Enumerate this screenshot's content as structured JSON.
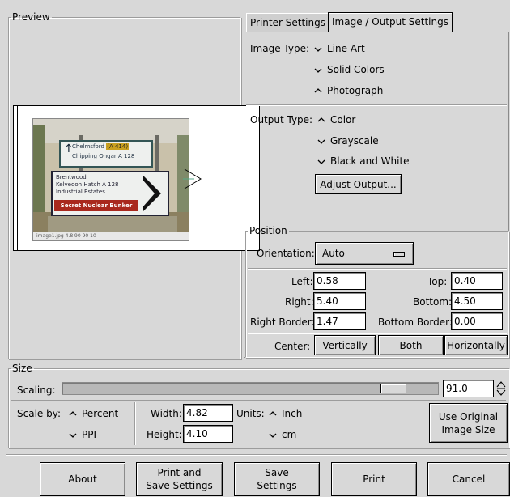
{
  "preview": {
    "frame_label": "Preview",
    "sign": {
      "line1": "Chelmsford",
      "line1_badge": "(A 414)",
      "line2": "Chipping Ongar  A 128",
      "line3": "Brentwood",
      "line4": "Kelvedon Hatch  A 128",
      "line5": "Industrial Estates",
      "banner": "Secret Nuclear Bunker"
    },
    "status_text": "image1.jpg 4.8 90 90 10"
  },
  "tabs": [
    {
      "label": "Printer Settings",
      "selected": false
    },
    {
      "label": "Image / Output Settings",
      "selected": true
    }
  ],
  "image_type": {
    "label": "Image Type:",
    "options": [
      "Line Art",
      "Solid Colors",
      "Photograph"
    ],
    "selected": "Photograph"
  },
  "output_type": {
    "label": "Output Type:",
    "options": [
      "Color",
      "Grayscale",
      "Black and White"
    ],
    "selected": "Color",
    "adjust_button": "Adjust Output..."
  },
  "position": {
    "frame_label": "Position",
    "orientation_label": "Orientation:",
    "orientation_value": "Auto",
    "left_label": "Left:",
    "left_value": "0.58",
    "top_label": "Top:",
    "top_value": "0.40",
    "right_label": "Right:",
    "right_value": "5.40",
    "bottom_label": "Bottom:",
    "bottom_value": "4.50",
    "right_border_label": "Right Border:",
    "right_border_value": "1.47",
    "bottom_border_label": "Bottom Border:",
    "bottom_border_value": "0.00",
    "center_label": "Center:",
    "center_buttons": [
      "Vertically",
      "Both",
      "Horizontally"
    ]
  },
  "size": {
    "frame_label": "Size",
    "scaling_label": "Scaling:",
    "scaling_value": "91.0",
    "scaling_fraction": 0.91,
    "scale_by_label": "Scale by:",
    "scale_by_options": [
      "Percent",
      "PPI"
    ],
    "scale_by_selected": "Percent",
    "width_label": "Width:",
    "width_value": "4.82",
    "height_label": "Height:",
    "height_value": "4.10",
    "units_label": "Units:",
    "units_options": [
      "Inch",
      "cm"
    ],
    "units_selected": "Inch",
    "original_size_button": "Use Original Image Size",
    "original_size_line1": "Use Original",
    "original_size_line2": "Image Size"
  },
  "actions": {
    "about": "About",
    "print_save_1": "Print and",
    "print_save_2": "Save Settings",
    "save_1": "Save",
    "save_2": "Settings",
    "print": "Print",
    "cancel": "Cancel"
  }
}
